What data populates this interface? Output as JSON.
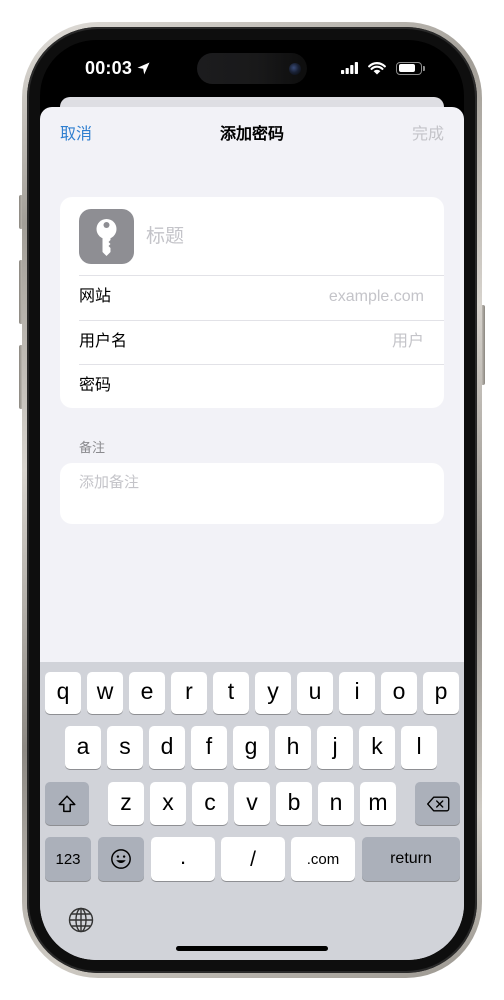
{
  "status_bar": {
    "time": "00:03",
    "location_icon": "location-arrow-icon",
    "signal_icon": "signal-icon",
    "wifi_icon": "wifi-icon",
    "battery_icon": "battery-icon",
    "battery_level": 0.8
  },
  "nav": {
    "cancel_label": "取消",
    "title": "添加密码",
    "done_label": "完成"
  },
  "entry": {
    "icon": "key-icon",
    "title_placeholder": "标题",
    "fields": [
      {
        "label": "网站",
        "placeholder": "example.com"
      },
      {
        "label": "用户名",
        "placeholder": "用户"
      },
      {
        "label": "密码"
      }
    ]
  },
  "notes": {
    "section_label": "备注",
    "placeholder": "添加备注"
  },
  "keyboard": {
    "row1": [
      "q",
      "w",
      "e",
      "r",
      "t",
      "y",
      "u",
      "i",
      "o",
      "p"
    ],
    "row2": [
      "a",
      "s",
      "d",
      "f",
      "g",
      "h",
      "j",
      "k",
      "l"
    ],
    "row3": [
      "z",
      "x",
      "c",
      "v",
      "b",
      "n",
      "m"
    ],
    "shift_icon": "shift-icon",
    "delete_icon": "delete-icon",
    "numbers_label": "123",
    "emoji_icon": "emoji-icon",
    "period_label": ".",
    "slash_label": "/",
    "dotcom_label": ".com",
    "return_label": "return",
    "globe_icon": "globe-icon"
  },
  "colors": {
    "accent": "#2f7fd0",
    "disabled_text": "#c4c4c9",
    "sheet_background": "#f2f2f7",
    "keyboard_background": "#d1d3d9",
    "special_key": "#abb0ba",
    "site_icon_background": "#8e8e93"
  }
}
